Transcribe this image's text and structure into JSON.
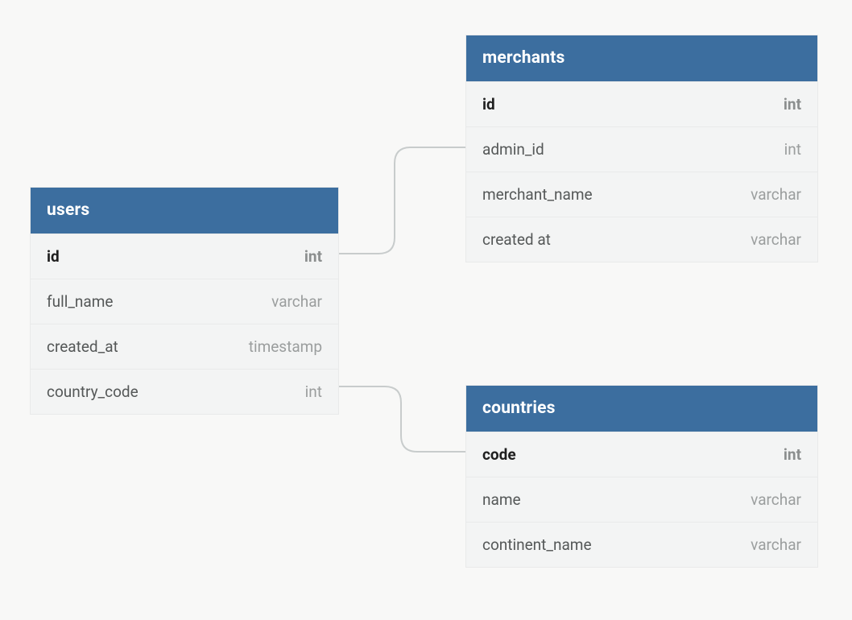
{
  "tables": {
    "users": {
      "title": "users",
      "columns": [
        {
          "name": "id",
          "type": "int",
          "pk": true
        },
        {
          "name": "full_name",
          "type": "varchar",
          "pk": false
        },
        {
          "name": "created_at",
          "type": "timestamp",
          "pk": false
        },
        {
          "name": "country_code",
          "type": "int",
          "pk": false
        }
      ]
    },
    "merchants": {
      "title": "merchants",
      "columns": [
        {
          "name": "id",
          "type": "int",
          "pk": true
        },
        {
          "name": "admin_id",
          "type": "int",
          "pk": false
        },
        {
          "name": "merchant_name",
          "type": "varchar",
          "pk": false
        },
        {
          "name": "created at",
          "type": "varchar",
          "pk": false
        }
      ]
    },
    "countries": {
      "title": "countries",
      "columns": [
        {
          "name": "code",
          "type": "int",
          "pk": true
        },
        {
          "name": "name",
          "type": "varchar",
          "pk": false
        },
        {
          "name": "continent_name",
          "type": "varchar",
          "pk": false
        }
      ]
    }
  },
  "relationships": [
    {
      "from": "users.id",
      "to": "merchants.admin_id"
    },
    {
      "from": "users.country_code",
      "to": "countries.code"
    }
  ]
}
